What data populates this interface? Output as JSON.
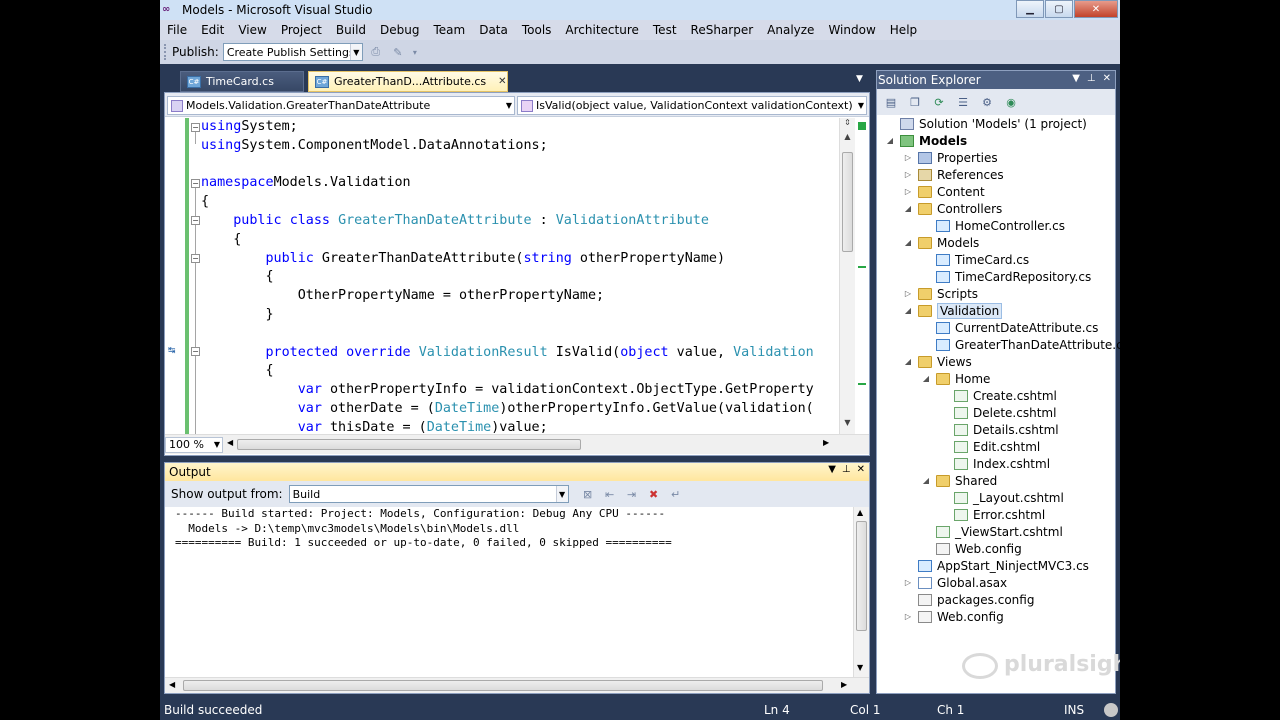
{
  "window": {
    "title": "Models - Microsoft Visual Studio",
    "minimize": "▁",
    "maximize": "▢",
    "close": "✕"
  },
  "menu": [
    "File",
    "Edit",
    "View",
    "Project",
    "Build",
    "Debug",
    "Team",
    "Data",
    "Tools",
    "Architecture",
    "Test",
    "ReSharper",
    "Analyze",
    "Window",
    "Help"
  ],
  "toolbar": {
    "publish_label": "Publish:",
    "publish_value": "Create Publish Settings"
  },
  "tabs": [
    {
      "label": "TimeCard.cs",
      "active": false
    },
    {
      "label": "GreaterThanD...Attribute.cs",
      "active": true
    }
  ],
  "editor": {
    "type_combo": "Models.Validation.GreaterThanDateAttribute",
    "member_combo": "IsValid(object value, ValidationContext validationContext)",
    "zoom": "100 %",
    "lines": [
      [
        [
          "kw",
          "using"
        ],
        [
          "",
          "System;"
        ]
      ],
      [
        [
          "kw",
          "using"
        ],
        [
          "",
          "System.ComponentModel.DataAnnotations;"
        ]
      ],
      [],
      [
        [
          "kw",
          "namespace"
        ],
        [
          "",
          "Models.Validation"
        ]
      ],
      [
        [
          "",
          "{"
        ]
      ],
      [
        [
          "",
          "    "
        ],
        [
          "kw",
          "public"
        ],
        [
          "",
          " "
        ],
        [
          "kw",
          "class"
        ],
        [
          "",
          " "
        ],
        [
          "ty",
          "GreaterThanDateAttribute"
        ],
        [
          "",
          " : "
        ],
        [
          "ty",
          "ValidationAttribute"
        ]
      ],
      [
        [
          "",
          "    {"
        ]
      ],
      [
        [
          "",
          "        "
        ],
        [
          "kw",
          "public"
        ],
        [
          "",
          " GreaterThanDateAttribute("
        ],
        [
          "kw",
          "string"
        ],
        [
          "",
          " otherPropertyName)"
        ]
      ],
      [
        [
          "",
          "        {"
        ]
      ],
      [
        [
          "",
          "            OtherPropertyName = otherPropertyName;"
        ]
      ],
      [
        [
          "",
          "        }"
        ]
      ],
      [],
      [
        [
          "",
          "        "
        ],
        [
          "kw",
          "protected"
        ],
        [
          "",
          " "
        ],
        [
          "kw",
          "override"
        ],
        [
          "",
          " "
        ],
        [
          "ty",
          "ValidationResult"
        ],
        [
          "",
          " IsValid("
        ],
        [
          "kw",
          "object"
        ],
        [
          "",
          " value, "
        ],
        [
          "ty",
          "Validation"
        ]
      ],
      [
        [
          "",
          "        {"
        ]
      ],
      [
        [
          "",
          "            "
        ],
        [
          "kw",
          "var"
        ],
        [
          "",
          " otherPropertyInfo = validationContext.ObjectType.GetProperty"
        ]
      ],
      [
        [
          "",
          "            "
        ],
        [
          "kw",
          "var"
        ],
        [
          "",
          " otherDate = ("
        ],
        [
          "ty",
          "DateTime"
        ],
        [
          "",
          ")otherPropertyInfo.GetValue(validation("
        ]
      ],
      [
        [
          "",
          "            "
        ],
        [
          "kw",
          "var"
        ],
        [
          "",
          " thisDate = ("
        ],
        [
          "ty",
          "DateTime"
        ],
        [
          "",
          ")value;"
        ]
      ]
    ]
  },
  "output": {
    "title": "Output",
    "show_label": "Show output from:",
    "show_value": "Build",
    "lines": [
      "------ Build started: Project: Models, Configuration: Debug Any CPU ------",
      "  Models -> D:\\temp\\mvc3models\\Models\\bin\\Models.dll",
      "========== Build: 1 succeeded or up-to-date, 0 failed, 0 skipped =========="
    ]
  },
  "solution_explorer": {
    "title": "Solution Explorer",
    "nodes": [
      {
        "label": "Solution 'Models' (1 project)",
        "icon": "sol",
        "depth": 0,
        "exp": ""
      },
      {
        "label": "Models",
        "icon": "proj",
        "depth": 0,
        "exp": "◢",
        "bold": true
      },
      {
        "label": "Properties",
        "icon": "prop",
        "depth": 1,
        "exp": "▷"
      },
      {
        "label": "References",
        "icon": "refs",
        "depth": 1,
        "exp": "▷"
      },
      {
        "label": "Content",
        "icon": "folder",
        "depth": 1,
        "exp": "▷"
      },
      {
        "label": "Controllers",
        "icon": "folder",
        "depth": 1,
        "exp": "◢"
      },
      {
        "label": "HomeController.cs",
        "icon": "cs",
        "depth": 2,
        "exp": ""
      },
      {
        "label": "Models",
        "icon": "folder",
        "depth": 1,
        "exp": "◢"
      },
      {
        "label": "TimeCard.cs",
        "icon": "cs",
        "depth": 2,
        "exp": ""
      },
      {
        "label": "TimeCardRepository.cs",
        "icon": "cs",
        "depth": 2,
        "exp": ""
      },
      {
        "label": "Scripts",
        "icon": "folder",
        "depth": 1,
        "exp": "▷"
      },
      {
        "label": "Validation",
        "icon": "folder",
        "depth": 1,
        "exp": "◢",
        "selected": true
      },
      {
        "label": "CurrentDateAttribute.cs",
        "icon": "cs",
        "depth": 2,
        "exp": ""
      },
      {
        "label": "GreaterThanDateAttribute.cs",
        "icon": "cs",
        "depth": 2,
        "exp": ""
      },
      {
        "label": "Views",
        "icon": "folder",
        "depth": 1,
        "exp": "◢"
      },
      {
        "label": "Home",
        "icon": "folder",
        "depth": 2,
        "exp": "◢"
      },
      {
        "label": "Create.cshtml",
        "icon": "cshtml",
        "depth": 3,
        "exp": ""
      },
      {
        "label": "Delete.cshtml",
        "icon": "cshtml",
        "depth": 3,
        "exp": ""
      },
      {
        "label": "Details.cshtml",
        "icon": "cshtml",
        "depth": 3,
        "exp": ""
      },
      {
        "label": "Edit.cshtml",
        "icon": "cshtml",
        "depth": 3,
        "exp": ""
      },
      {
        "label": "Index.cshtml",
        "icon": "cshtml",
        "depth": 3,
        "exp": ""
      },
      {
        "label": "Shared",
        "icon": "folder",
        "depth": 2,
        "exp": "◢"
      },
      {
        "label": "_Layout.cshtml",
        "icon": "cshtml",
        "depth": 3,
        "exp": ""
      },
      {
        "label": "Error.cshtml",
        "icon": "cshtml",
        "depth": 3,
        "exp": ""
      },
      {
        "label": "_ViewStart.cshtml",
        "icon": "cshtml",
        "depth": 2,
        "exp": ""
      },
      {
        "label": "Web.config",
        "icon": "config",
        "depth": 2,
        "exp": ""
      },
      {
        "label": "AppStart_NinjectMVC3.cs",
        "icon": "cs",
        "depth": 1,
        "exp": ""
      },
      {
        "label": "Global.asax",
        "icon": "file",
        "depth": 1,
        "exp": "▷"
      },
      {
        "label": "packages.config",
        "icon": "config",
        "depth": 1,
        "exp": ""
      },
      {
        "label": "Web.config",
        "icon": "config",
        "depth": 1,
        "exp": "▷"
      }
    ]
  },
  "watermark": "pluralsight",
  "status": {
    "message": "Build succeeded",
    "ln": "Ln 4",
    "col": "Col 1",
    "ch": "Ch 1",
    "mode": "INS"
  }
}
